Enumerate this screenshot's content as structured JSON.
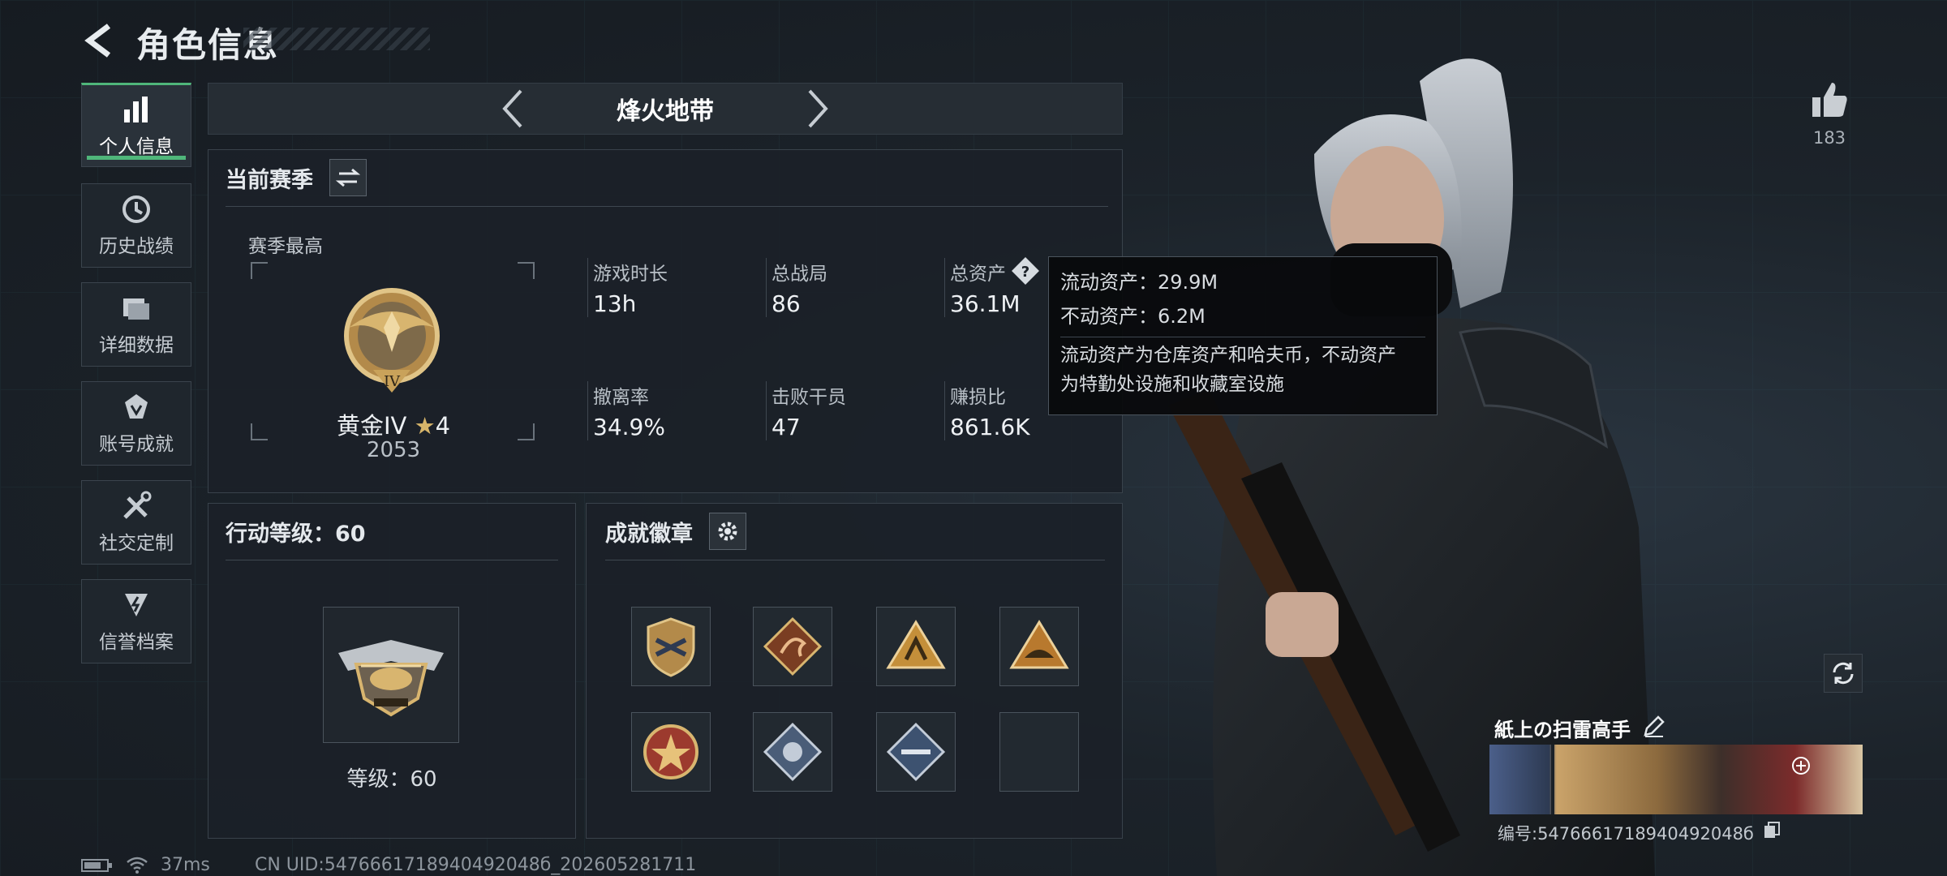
{
  "header": {
    "title": "角色信息"
  },
  "sidebar": {
    "items": [
      {
        "label": "个人信息",
        "icon": "bar-chart-icon",
        "active": true
      },
      {
        "label": "历史战绩",
        "icon": "history-clock-icon"
      },
      {
        "label": "详细数据",
        "icon": "folder-icon"
      },
      {
        "label": "账号成就",
        "icon": "achievement-icon"
      },
      {
        "label": "社交定制",
        "icon": "tools-icon"
      },
      {
        "label": "信誉档案",
        "icon": "reputation-icon"
      }
    ]
  },
  "mode_selector": {
    "title": "烽火地带"
  },
  "season": {
    "title": "当前赛季",
    "best_label": "赛季最高",
    "rank_name": "黄金IV",
    "rank_star": "★",
    "rank_stars": "4",
    "rank_points": "2053",
    "rank_emblem_roman": "IV",
    "stats": [
      {
        "label": "游戏时长",
        "value": "13h"
      },
      {
        "label": "总战局",
        "value": "86"
      },
      {
        "label": "总资产",
        "value": "36.1M"
      },
      {
        "label": "撤离率",
        "value": "34.9%"
      },
      {
        "label": "击败干员",
        "value": "47"
      },
      {
        "label": "赚损比",
        "value": "861.6K"
      }
    ]
  },
  "tooltip": {
    "liquid": "流动资产：29.9M",
    "fixed": "不动资产：6.2M",
    "desc_line1": "流动资产为仓库资产和哈夫币，不动资产",
    "desc_line2": "为特勤处设施和收藏室设施"
  },
  "action_level": {
    "title": "行动等级：60",
    "level_label": "等级：60"
  },
  "badges": {
    "title": "成就徽章",
    "items": [
      "shield-badge-icon",
      "dragon-badge-icon",
      "triangle-badge-icon",
      "triangle-badge-2-icon",
      "star-shield-badge-icon",
      "diamond-badge-icon",
      "diamond-badge-2-icon",
      "empty-badge-slot"
    ]
  },
  "likes": {
    "count": "183"
  },
  "profile": {
    "name": "紙上の扫雷高手",
    "uid_label": "编号:5476661718940492048б"
  },
  "status_bar": {
    "ping": "37ms",
    "uid": "CN UID:5476661718940492048б_202605281711"
  },
  "colors": {
    "accent": "#4fb67a",
    "gold": "#c9a25a"
  }
}
